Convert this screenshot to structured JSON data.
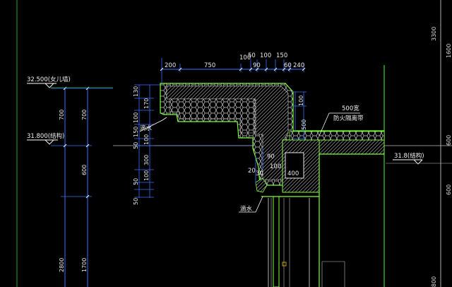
{
  "colors": {
    "background": "#000000",
    "dimension": "#3a6fff",
    "outline": "#7cff3a",
    "fill": "#c8c8c8",
    "text": "#f0f0f0",
    "marker": "#e0b000"
  },
  "levels": {
    "parapet": "32.500(女儿墙)",
    "structure_top": "31.800(结构)",
    "structure_right": "31.8(结构)"
  },
  "top_dims": {
    "d200": "200",
    "d750": "750",
    "d100a": "100",
    "d50": "50",
    "d100b": "100",
    "d90": "90",
    "d150": "150",
    "d60": "60",
    "d240": "240"
  },
  "left_dims": {
    "d700a": "700",
    "d700b": "700",
    "d600": "600",
    "d2800": "2800",
    "d1700": "1700"
  },
  "col_dims": {
    "d130": "130",
    "d170": "170",
    "d100": "100",
    "d150": "150",
    "d50a": "50",
    "d100b": "100",
    "d300": "300",
    "d50b": "50",
    "d100c": "100",
    "d50c": "50"
  },
  "right_dims": {
    "d3300": "3300",
    "d1600": "1600",
    "d600a": "600",
    "d600b": "600",
    "d800": "800"
  },
  "inner_dims": {
    "d100": "100",
    "d500": "500",
    "d400": "400",
    "d20": "20",
    "d30": "30",
    "d90": "90",
    "d100b": "100"
  },
  "notes": {
    "drip_upper": "滴水",
    "drip_lower": "滴水",
    "firebreak_width": "500宽",
    "firebreak_label": "防火隔离带"
  }
}
